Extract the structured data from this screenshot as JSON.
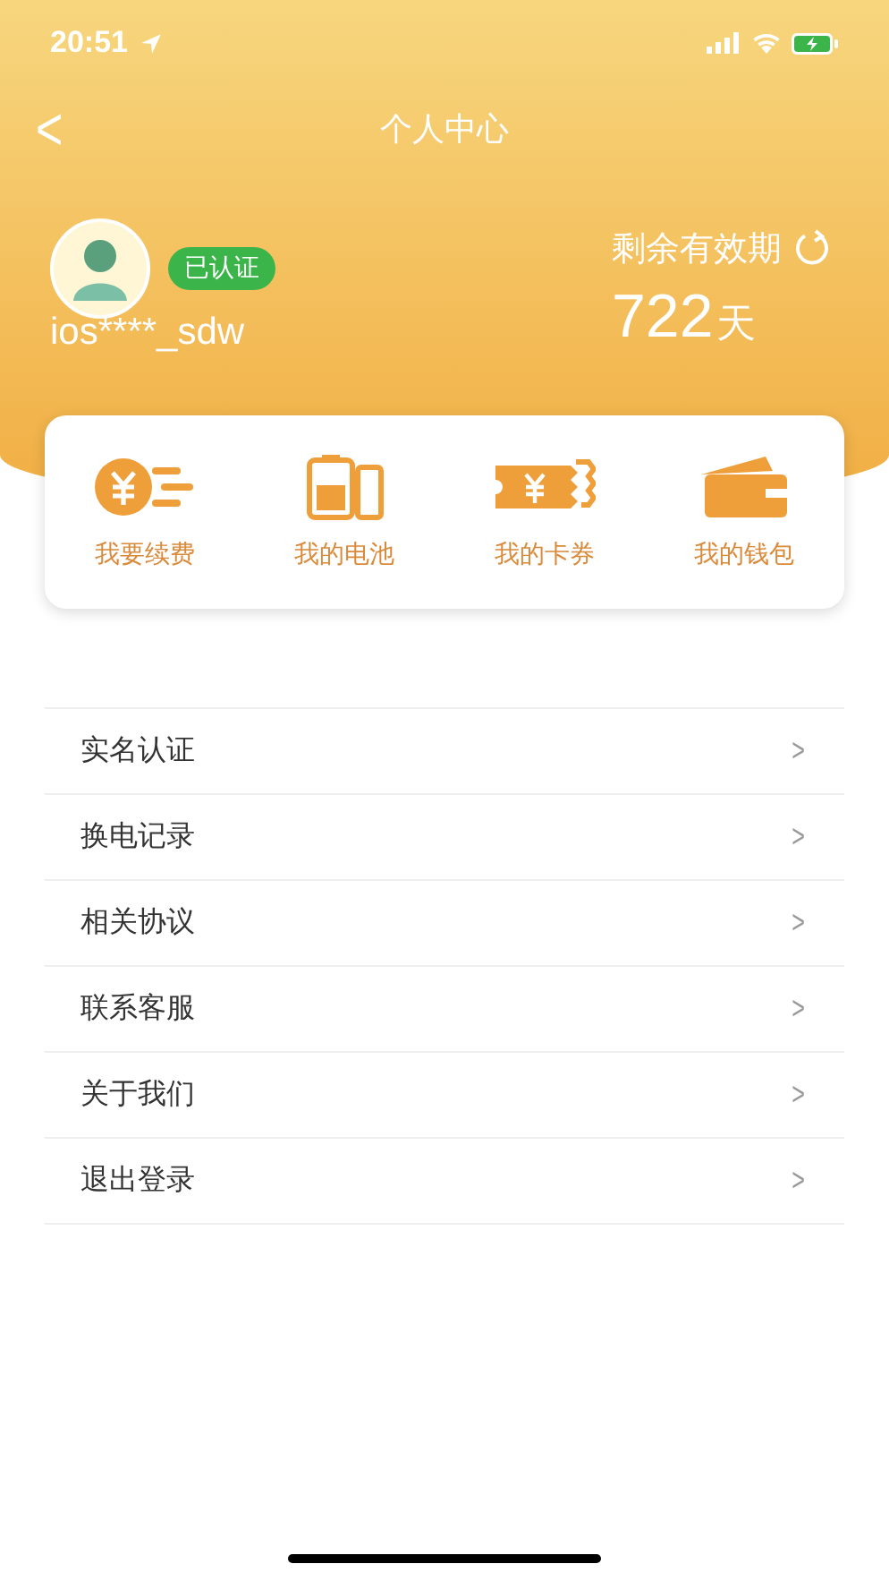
{
  "status_bar": {
    "time": "20:51"
  },
  "nav": {
    "back": "<",
    "title": "个人中心"
  },
  "profile": {
    "username": "ios****_sdw",
    "verified": true,
    "badge": "已认证",
    "validity_label": "剩余有效期",
    "days": "722",
    "days_unit": "天"
  },
  "shortcuts": [
    {
      "kind": "coin",
      "label": "我要续费"
    },
    {
      "kind": "battery",
      "label": "我的电池"
    },
    {
      "kind": "ticket",
      "label": "我的卡券"
    },
    {
      "kind": "wallet",
      "label": "我的钱包"
    }
  ],
  "menu": [
    {
      "label": "实名认证",
      "chevron": ">"
    },
    {
      "label": "换电记录",
      "chevron": ">"
    },
    {
      "label": "相关协议",
      "chevron": ">"
    },
    {
      "label": "联系客服",
      "chevron": ">"
    },
    {
      "label": "关于我们",
      "chevron": ">"
    },
    {
      "label": "退出登录",
      "chevron": ">"
    }
  ]
}
